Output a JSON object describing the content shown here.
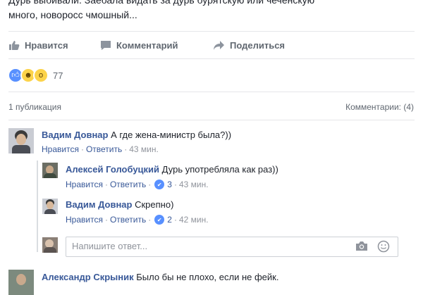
{
  "post": {
    "text_line1": "Дурь выбивали. Заебала видать за дурь бурятскую или чеченскую",
    "text_line2": "много, новоросс чмошный..."
  },
  "actions": {
    "like": "Нравится",
    "comment": "Комментарий",
    "share": "Поделиться"
  },
  "reactions": {
    "count": "77",
    "types": [
      "like-icon",
      "haha-icon",
      "wow-icon"
    ]
  },
  "stats": {
    "publications": "1 публикация",
    "comments": "Комментарии: (4)"
  },
  "comments": [
    {
      "author": "Вадим Довнар",
      "text": "А где жена-министр была?))",
      "like_label": "Нравится",
      "reply_label": "Ответить",
      "time": "43 мин."
    },
    {
      "author": "Алексей Голобуцкий",
      "text": "Дурь употребляла как раз))",
      "like_label": "Нравится",
      "reply_label": "Ответить",
      "likes": "3",
      "time": "43 мин."
    },
    {
      "author": "Вадим Довнар",
      "text": "Скрепно)",
      "like_label": "Нравится",
      "reply_label": "Ответить",
      "likes": "2",
      "time": "42 мин."
    },
    {
      "author": "Александр Скрыник",
      "text": "Было бы не плохо, если не фейк."
    }
  ],
  "reply": {
    "placeholder": "Напишите ответ..."
  },
  "colors": {
    "link": "#385898",
    "meta": "#90949c",
    "divider": "#e5e6e9",
    "like_blue": "#5890ff"
  }
}
